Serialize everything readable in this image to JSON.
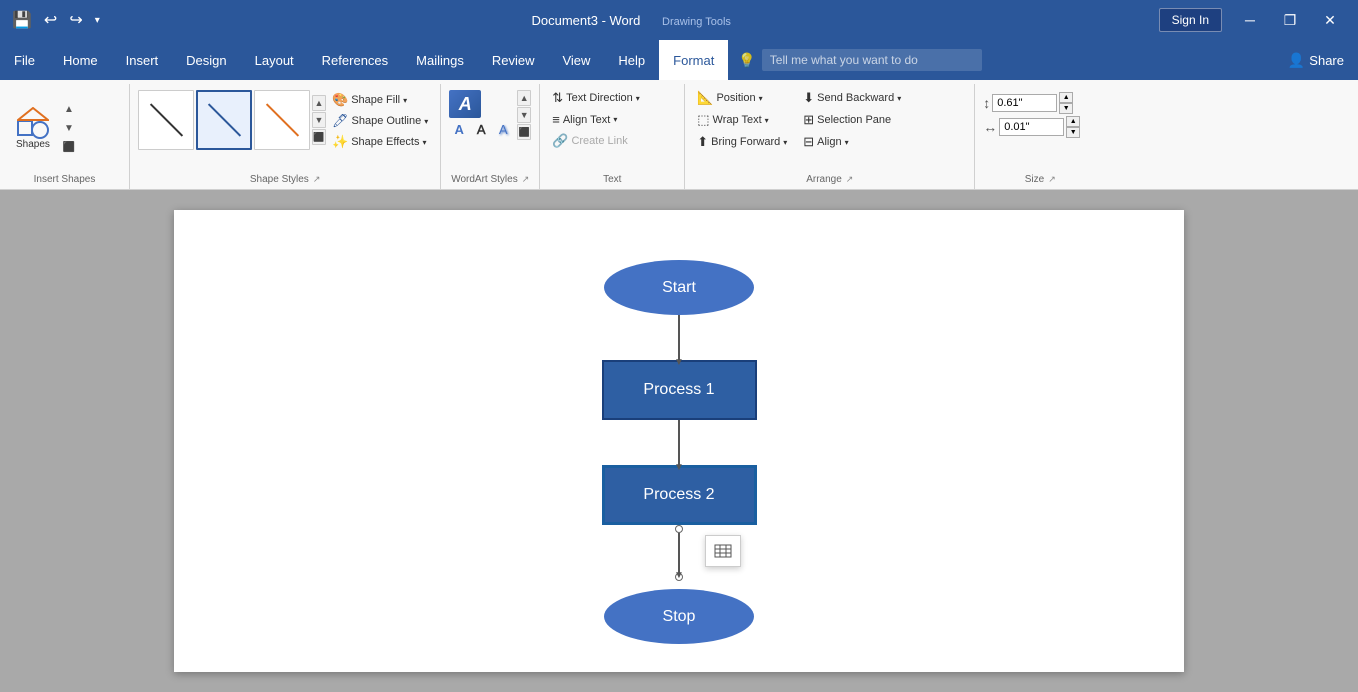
{
  "titlebar": {
    "doc_title": "Document3 - Word",
    "drawing_tools": "Drawing Tools",
    "sign_in": "Sign In",
    "qat": {
      "save": "💾",
      "undo": "↩",
      "redo": "↪",
      "more": "▾"
    },
    "window_controls": {
      "minimize": "─",
      "restore": "❐",
      "close": "✕"
    }
  },
  "menubar": {
    "items": [
      {
        "label": "File",
        "active": false
      },
      {
        "label": "Home",
        "active": false
      },
      {
        "label": "Insert",
        "active": false
      },
      {
        "label": "Design",
        "active": false
      },
      {
        "label": "Layout",
        "active": false
      },
      {
        "label": "References",
        "active": false
      },
      {
        "label": "Mailings",
        "active": false
      },
      {
        "label": "Review",
        "active": false
      },
      {
        "label": "View",
        "active": false
      },
      {
        "label": "Help",
        "active": false
      },
      {
        "label": "Format",
        "active": true
      }
    ],
    "tell_me_placeholder": "Tell me what you want to do",
    "share": "Share"
  },
  "ribbon": {
    "insert_shapes": {
      "label": "Insert Shapes",
      "shapes_label": "Shapes"
    },
    "shape_styles": {
      "label": "Shape Styles",
      "fill": "Shape Fill",
      "outline": "Shape Outline",
      "effects": "Shape Effects"
    },
    "wordart_styles": {
      "label": "WordArt Styles"
    },
    "text": {
      "label": "Text",
      "direction": "Text Direction",
      "align": "Align Text",
      "create_link": "Create Link"
    },
    "arrange": {
      "label": "Arrange",
      "position": "Position",
      "wrap_text": "Wrap Text",
      "bring_forward": "Bring Forward",
      "send_backward": "Send Backward",
      "selection_pane": "Selection Pane",
      "align": "Align"
    },
    "size": {
      "label": "Size",
      "height": "0.61\"",
      "width": "0.01\""
    }
  },
  "flowchart": {
    "start_label": "Start",
    "process1_label": "Process 1",
    "process2_label": "Process 2",
    "stop_label": "Stop"
  },
  "colors": {
    "title_bar_bg": "#2b579a",
    "menu_active_bg": "white",
    "menu_active_fg": "#2b579a",
    "shape_fill": "#4472c4",
    "shape_dark": "#2e5fa3",
    "canvas_bg": "#a9a9a9",
    "doc_bg": "white"
  }
}
